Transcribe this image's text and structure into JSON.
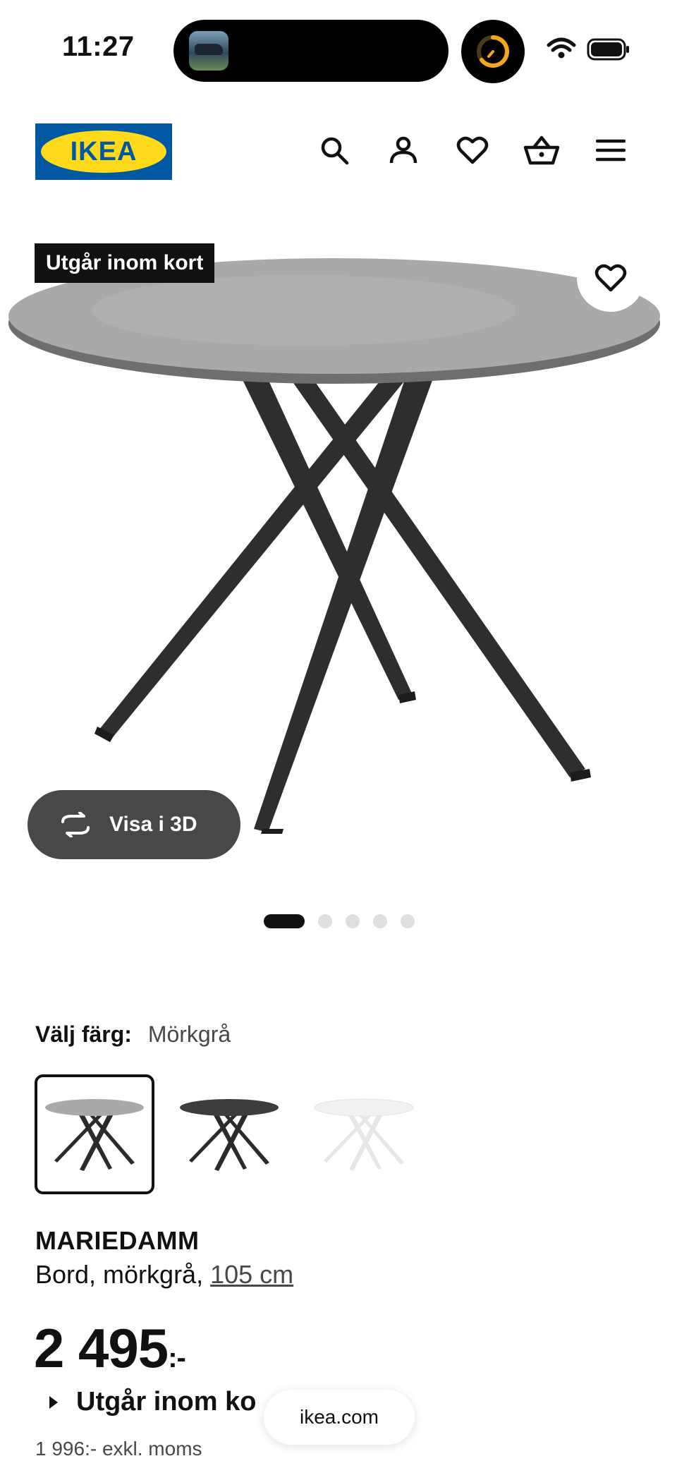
{
  "status_bar": {
    "time": "11:27"
  },
  "header": {
    "logo_text": "IKEA",
    "icons": [
      "search-icon",
      "account-icon",
      "heart-icon",
      "cart-icon",
      "menu-icon"
    ]
  },
  "product_image": {
    "badge": "Utgår inom kort",
    "view3d_label": "Visa i 3D",
    "pagination": {
      "current": 1,
      "total": 5
    }
  },
  "color_select": {
    "label": "Välj färg:",
    "selected": "Mörkgrå",
    "options": [
      "Mörkgrå",
      "Svart",
      "Vit"
    ]
  },
  "product": {
    "name": "MARIEDAMM",
    "description_prefix": "Bord, mörkgrå, ",
    "size_link": "105 cm",
    "price": "2 495",
    "price_suffix": ":-",
    "availability": "Utgår inom ko",
    "excl_vat": "1 996:- exkl. moms"
  },
  "browser": {
    "url": "ikea.com"
  },
  "colors": {
    "brand_blue": "#0058a3",
    "brand_yellow": "#ffda1a",
    "badge_bg": "#111111",
    "view3d_bg": "#484848"
  }
}
